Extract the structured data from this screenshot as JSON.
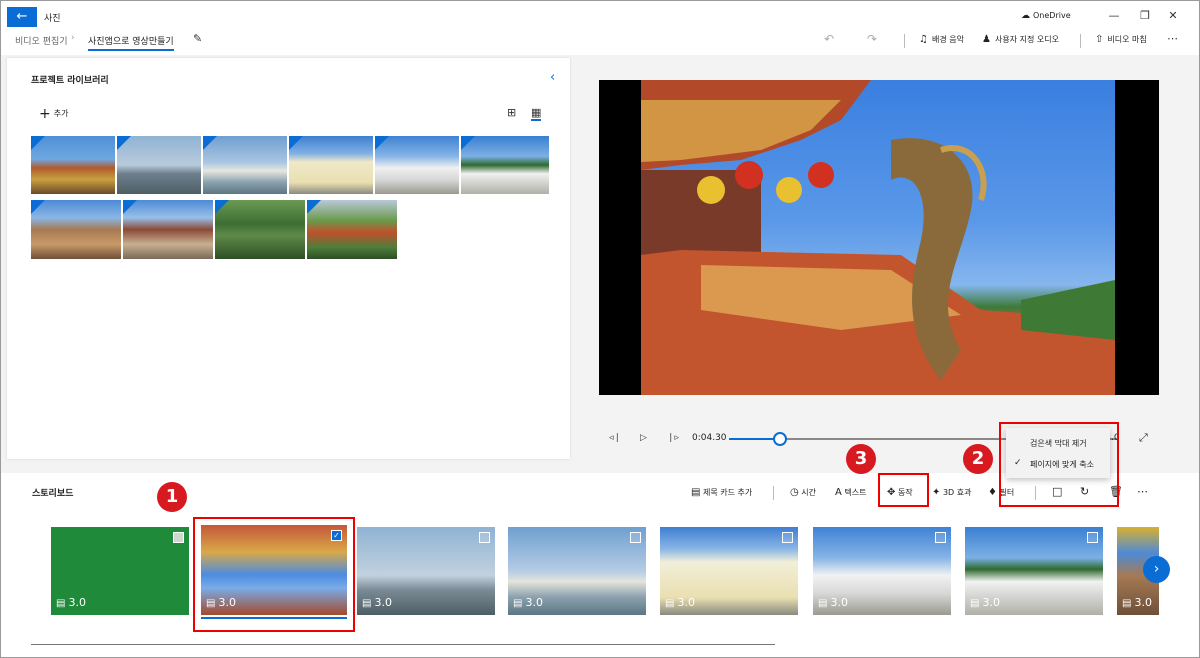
{
  "titlebar": {
    "app_title": "사진",
    "onedrive_label": "OneDrive",
    "back_icon": "arrow-left-icon"
  },
  "breadcrumb": {
    "parent": "비디오 편집기",
    "current": "사진앱으로 영상만들기"
  },
  "toolbar": {
    "background_music": "배경 음악",
    "custom_audio": "사용자 지정 오디오",
    "finish_video": "비디오 마침"
  },
  "library": {
    "title": "프로젝트 라이브러리",
    "add_label": "추가"
  },
  "playback": {
    "time": "0:04.30",
    "end_time_partial": ".0",
    "progress_fraction": 0.13
  },
  "menu": {
    "items": [
      {
        "label": "검은색 막대 제거",
        "checked": false
      },
      {
        "label": "페이지에 맞게 축소",
        "checked": true
      }
    ]
  },
  "annotations": {
    "badge1": "1",
    "badge2": "2",
    "badge3": "3"
  },
  "storyboard": {
    "title": "스토리보드",
    "tools": {
      "title_card": "제목 카드 추가",
      "duration": "시간",
      "text": "텍스트",
      "motion": "동작",
      "effects_3d": "3D 효과",
      "filters": "필터"
    },
    "clips": [
      {
        "duration": "3.0",
        "selected": false
      },
      {
        "duration": "3.0",
        "selected": true
      },
      {
        "duration": "3.0",
        "selected": false
      },
      {
        "duration": "3.0",
        "selected": false
      },
      {
        "duration": "3.0",
        "selected": false
      },
      {
        "duration": "3.0",
        "selected": false
      },
      {
        "duration": "3.0",
        "selected": false
      },
      {
        "duration": "3.0",
        "selected": false
      }
    ]
  },
  "colors": {
    "accent": "#0a6dd6",
    "annotation_red": "#e00000"
  }
}
